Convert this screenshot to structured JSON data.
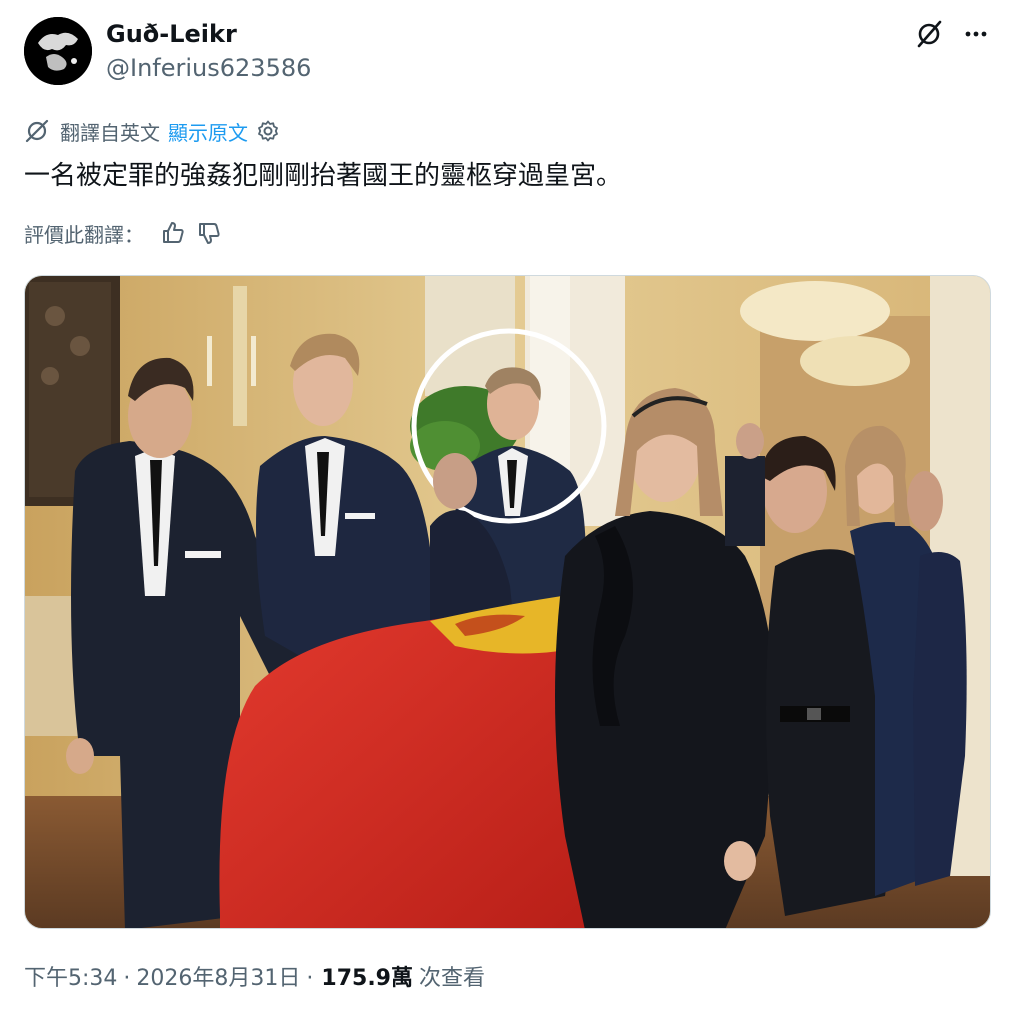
{
  "author": {
    "display_name": "Guð-Leikr",
    "handle": "@Inferius623586"
  },
  "header_icons": [
    "grok-icon",
    "more-icon"
  ],
  "translation": {
    "label": "翻譯自英文",
    "show_original": "顯示原文"
  },
  "tweet": {
    "text": "一名被定罪的強姦犯剛剛抬著國王的靈柩穿過皇宮。"
  },
  "rating": {
    "label": "評價此翻譯："
  },
  "meta": {
    "time": "下午5:34",
    "separator": "·",
    "date": "2026年8月31日",
    "views_count": "175.9萬",
    "views_label": "次查看"
  },
  "colors": {
    "text_primary": "#0f1419",
    "text_secondary": "#536471",
    "link": "#1d9bf0",
    "flag_red": "#d42a22",
    "flag_gold": "#e7b628"
  }
}
